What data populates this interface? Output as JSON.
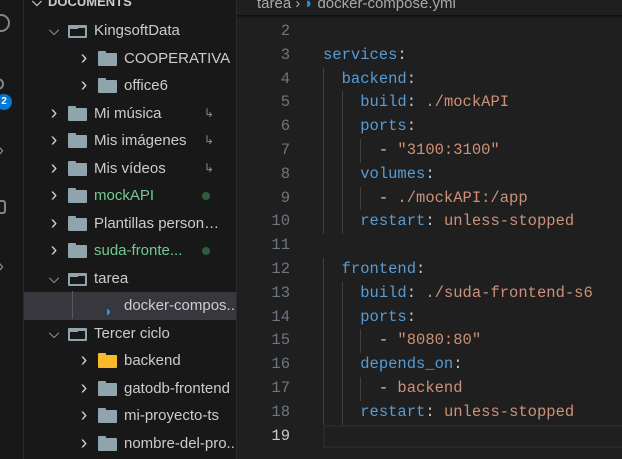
{
  "explorer": {
    "section_title": "DOCUMENTS",
    "items": [
      {
        "label": "KingsoftData",
        "depth": 1,
        "type": "folder",
        "expanded": true
      },
      {
        "label": "COOPERATIVA",
        "depth": 2,
        "type": "folder",
        "expanded": false
      },
      {
        "label": "office6",
        "depth": 2,
        "type": "folder",
        "expanded": false
      },
      {
        "label": "Mi música",
        "depth": 1,
        "type": "folder",
        "expanded": false,
        "symlink": true
      },
      {
        "label": "Mis imágenes",
        "depth": 1,
        "type": "folder",
        "expanded": false,
        "symlink": true
      },
      {
        "label": "Mis vídeos",
        "depth": 1,
        "type": "folder",
        "expanded": false,
        "symlink": true
      },
      {
        "label": "mockAPI",
        "depth": 1,
        "type": "folder",
        "expanded": false,
        "modified": true
      },
      {
        "label": "Plantillas personal...",
        "depth": 1,
        "type": "folder",
        "expanded": false
      },
      {
        "label": "suda-fronte...",
        "depth": 1,
        "type": "folder",
        "expanded": false,
        "modified": true
      },
      {
        "label": "tarea",
        "depth": 1,
        "type": "folder",
        "expanded": true
      },
      {
        "label": "docker-compos...",
        "depth": 2,
        "type": "docker-file",
        "selected": true
      },
      {
        "label": "Tercer ciclo",
        "depth": 1,
        "type": "folder",
        "expanded": true
      },
      {
        "label": "backend",
        "depth": 2,
        "type": "special-folder",
        "expanded": false
      },
      {
        "label": "gatodb-frontend",
        "depth": 2,
        "type": "folder",
        "expanded": false
      },
      {
        "label": "mi-proyecto-ts",
        "depth": 2,
        "type": "folder",
        "expanded": false
      },
      {
        "label": "nombre-del-pro...",
        "depth": 2,
        "type": "folder",
        "expanded": false
      }
    ]
  },
  "activity": {
    "badge": "2"
  },
  "breadcrumb": {
    "folder": "tarea",
    "file": "docker-compose.yml"
  },
  "editor": {
    "current_line": 19,
    "lines": [
      {
        "n": "2",
        "indent": 0,
        "tokens": []
      },
      {
        "n": "3",
        "indent": 0,
        "tokens": [
          {
            "t": "services",
            "c": "k"
          },
          {
            "t": ":",
            "c": "p"
          }
        ]
      },
      {
        "n": "4",
        "indent": 1,
        "tokens": [
          {
            "t": "backend",
            "c": "k"
          },
          {
            "t": ":",
            "c": "p"
          }
        ]
      },
      {
        "n": "5",
        "indent": 2,
        "tokens": [
          {
            "t": "build",
            "c": "k"
          },
          {
            "t": ": ",
            "c": "p"
          },
          {
            "t": "./mockAPI",
            "c": "s"
          }
        ]
      },
      {
        "n": "6",
        "indent": 2,
        "tokens": [
          {
            "t": "ports",
            "c": "k"
          },
          {
            "t": ":",
            "c": "p"
          }
        ]
      },
      {
        "n": "7",
        "indent": 3,
        "tokens": [
          {
            "t": "- ",
            "c": "p"
          },
          {
            "t": "\"3100:3100\"",
            "c": "s"
          }
        ]
      },
      {
        "n": "8",
        "indent": 2,
        "tokens": [
          {
            "t": "volumes",
            "c": "k"
          },
          {
            "t": ":",
            "c": "p"
          }
        ]
      },
      {
        "n": "9",
        "indent": 3,
        "tokens": [
          {
            "t": "- ",
            "c": "p"
          },
          {
            "t": "./mockAPI:/app",
            "c": "s"
          }
        ]
      },
      {
        "n": "10",
        "indent": 2,
        "tokens": [
          {
            "t": "restart",
            "c": "k"
          },
          {
            "t": ": ",
            "c": "p"
          },
          {
            "t": "unless-stopped",
            "c": "s"
          }
        ]
      },
      {
        "n": "11",
        "indent": 0,
        "tokens": []
      },
      {
        "n": "12",
        "indent": 1,
        "tokens": [
          {
            "t": "frontend",
            "c": "k"
          },
          {
            "t": ":",
            "c": "p"
          }
        ]
      },
      {
        "n": "13",
        "indent": 2,
        "tokens": [
          {
            "t": "build",
            "c": "k"
          },
          {
            "t": ": ",
            "c": "p"
          },
          {
            "t": "./suda-frontend-s6",
            "c": "s"
          }
        ]
      },
      {
        "n": "14",
        "indent": 2,
        "tokens": [
          {
            "t": "ports",
            "c": "k"
          },
          {
            "t": ":",
            "c": "p"
          }
        ]
      },
      {
        "n": "15",
        "indent": 3,
        "tokens": [
          {
            "t": "- ",
            "c": "p"
          },
          {
            "t": "\"8080:80\"",
            "c": "s"
          }
        ]
      },
      {
        "n": "16",
        "indent": 2,
        "tokens": [
          {
            "t": "depends_on",
            "c": "k"
          },
          {
            "t": ":",
            "c": "p"
          }
        ]
      },
      {
        "n": "17",
        "indent": 3,
        "tokens": [
          {
            "t": "- ",
            "c": "p"
          },
          {
            "t": "backend",
            "c": "s"
          }
        ]
      },
      {
        "n": "18",
        "indent": 2,
        "tokens": [
          {
            "t": "restart",
            "c": "k"
          },
          {
            "t": ": ",
            "c": "p"
          },
          {
            "t": "unless-stopped",
            "c": "s"
          }
        ]
      },
      {
        "n": "19",
        "indent": 0,
        "tokens": []
      }
    ]
  }
}
